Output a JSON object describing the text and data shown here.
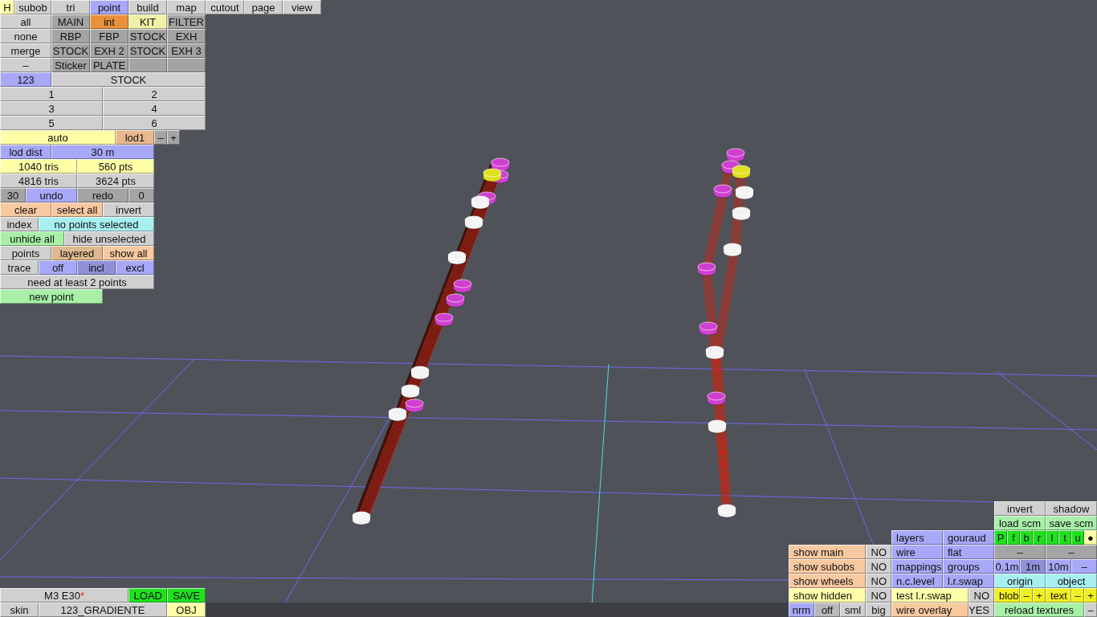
{
  "help_button": {
    "label": "H",
    "color": "#ffffa8"
  },
  "tabs": [
    {
      "label": "subob",
      "selected": false
    },
    {
      "label": "tri",
      "selected": false
    },
    {
      "label": "point",
      "selected": true
    },
    {
      "label": "build",
      "selected": false
    },
    {
      "label": "map",
      "selected": false
    },
    {
      "label": "cutout",
      "selected": false
    },
    {
      "label": "page",
      "selected": false
    },
    {
      "label": "view",
      "selected": false
    }
  ],
  "left_panel": [
    [
      {
        "label": "all",
        "color": "#d0d0d0"
      },
      {
        "label": "MAIN",
        "color": "#a4a4a4"
      },
      {
        "label": "int",
        "color": "#e8903c"
      },
      {
        "label": "KIT",
        "color": "#f0f0a8"
      },
      {
        "label": "FILTER",
        "color": "#a4a4a4"
      }
    ],
    [
      {
        "label": "none",
        "color": "#d0d0d0"
      },
      {
        "label": "RBP",
        "color": "#a4a4a4"
      },
      {
        "label": "FBP",
        "color": "#a4a4a4"
      },
      {
        "label": "STOCK",
        "color": "#a4a4a4"
      },
      {
        "label": "EXH",
        "color": "#a4a4a4"
      }
    ],
    [
      {
        "label": "merge",
        "color": "#d0d0d0"
      },
      {
        "label": "STOCK",
        "color": "#a4a4a4"
      },
      {
        "label": "EXH 2",
        "color": "#a4a4a4"
      },
      {
        "label": "STOCK",
        "color": "#a4a4a4"
      },
      {
        "label": "EXH 3",
        "color": "#a4a4a4"
      }
    ],
    [
      {
        "label": "–",
        "color": "#d0d0d0"
      },
      {
        "label": "Sticker",
        "color": "#a4a4a4"
      },
      {
        "label": "PLATE",
        "color": "#a4a4a4"
      },
      {
        "color": "#a4a4a4"
      },
      {
        "color": "#a4a4a4"
      }
    ],
    [
      {
        "label": "123",
        "color": "#a8a8f8"
      },
      {
        "label": "STOCK",
        "color": "#d0d0d0"
      }
    ],
    [
      {
        "label": "1",
        "color": "#d0d0d0"
      },
      {
        "label": "2",
        "color": "#d0d0d0"
      }
    ],
    [
      {
        "label": "3",
        "color": "#d0d0d0"
      },
      {
        "label": "4",
        "color": "#d0d0d0"
      }
    ],
    [
      {
        "label": "5",
        "color": "#d0d0d0"
      },
      {
        "label": "6",
        "color": "#d0d0d0"
      }
    ],
    [
      {
        "label": "auto",
        "color": "#ffffa8"
      },
      {
        "label": "lod1",
        "color": "#e8b890"
      },
      {
        "label": "–",
        "color": "#a4a4a4"
      },
      {
        "label": "+",
        "color": "#a4a4a4"
      }
    ],
    [
      {
        "label": "lod dist",
        "color": "#a8a8f8"
      },
      {
        "label": "30 m",
        "color": "#a8a8f8"
      }
    ],
    [
      {
        "label": "1040 tris",
        "color": "#ffffa8"
      },
      {
        "label": "560 pts",
        "color": "#ffffa8"
      }
    ],
    [
      {
        "label": "4816 tris",
        "color": "#d0d0d0"
      },
      {
        "label": "3624 pts",
        "color": "#d0d0d0"
      }
    ],
    [
      {
        "label": "30",
        "color": "#a4a4a4"
      },
      {
        "label": "undo",
        "color": "#a8a8f8"
      },
      {
        "label": "redo",
        "color": "#a4a4a4"
      },
      {
        "label": "0",
        "color": "#a4a4a4"
      }
    ],
    [
      {
        "label": "clear",
        "color": "#f8c8a0"
      },
      {
        "label": "select all",
        "color": "#f8c8a0"
      },
      {
        "label": "invert",
        "color": "#d0d0d0"
      }
    ],
    [
      {
        "label": "index",
        "color": "#d0d0d0"
      },
      {
        "label": "no points selected",
        "color": "#a8f0f0"
      }
    ],
    [
      {
        "label": "unhide all",
        "color": "#a8f0a8"
      },
      {
        "label": "hide unselected",
        "color": "#d0d0d0"
      }
    ],
    [
      {
        "label": "points",
        "color": "#d0d0d0"
      },
      {
        "label": "layered",
        "color": "#e0b890"
      },
      {
        "label": "show all",
        "color": "#f8c8a0"
      }
    ],
    [
      {
        "label": "trace",
        "color": "#d0d0d0"
      },
      {
        "label": "off",
        "color": "#a8a8f8"
      },
      {
        "label": "incl",
        "color": "#9090d8"
      },
      {
        "label": "excl",
        "color": "#a8a8f8"
      }
    ],
    [
      {
        "label": "need at least 2 points",
        "color": "#d0d0d0"
      }
    ],
    [
      {
        "label": "new point",
        "color": "#a8f0a8"
      }
    ]
  ],
  "file_panel": [
    [
      {
        "label": "M3 E30",
        "mark": "*",
        "color": "#d0d0d0"
      },
      {
        "label": "LOAD",
        "color": "#20e020"
      },
      {
        "label": "SAVE",
        "color": "#20e020"
      }
    ],
    [
      {
        "label": "skin",
        "color": "#d0d0d0"
      },
      {
        "label": "123_GRADIENTE",
        "color": "#d0d0d0"
      },
      {
        "label": "OBJ",
        "color": "#ffffa8"
      }
    ]
  ],
  "view_panel": [
    [
      {
        "label": "invert",
        "color": "#d0d0d0"
      },
      {
        "label": "shadow",
        "color": "#d0d0d0"
      }
    ],
    [
      {
        "label": "load scm",
        "color": "#a8f0a8"
      },
      {
        "label": "save scm",
        "color": "#a8f0a8"
      }
    ],
    [
      {
        "label": "layers",
        "color": "#a8a8f8"
      },
      {
        "label": "gouraud",
        "color": "#a8a8f8"
      },
      {
        "label": "P",
        "color": "#20e020"
      },
      {
        "label": "f",
        "color": "#20e020"
      },
      {
        "label": "b",
        "color": "#20e020"
      },
      {
        "label": "r",
        "color": "#20e020"
      },
      {
        "label": "l",
        "color": "#20e020"
      },
      {
        "label": "t",
        "color": "#20e020"
      },
      {
        "label": "u",
        "color": "#20e020"
      },
      {
        "label": "●",
        "color": "#ffffa8"
      }
    ],
    [
      {
        "label": "show main",
        "color": "#f8c8a0"
      },
      {
        "label": "NO",
        "color": "#d0d0d0"
      },
      {
        "label": "wire",
        "color": "#a8a8f8"
      },
      {
        "label": "flat",
        "color": "#a8a8f8"
      },
      {
        "label": "–",
        "color": "#a4a4a4"
      },
      {
        "label": "–",
        "color": "#a4a4a4"
      }
    ],
    [
      {
        "label": "show subobs",
        "color": "#f8c8a0"
      },
      {
        "label": "NO",
        "color": "#d0d0d0"
      },
      {
        "label": "mappings",
        "color": "#a8a8f8"
      },
      {
        "label": "groups",
        "color": "#a8a8f8"
      },
      {
        "label": "0.1m",
        "color": "#a8a8f8"
      },
      {
        "label": "1m",
        "color": "#9090d8"
      },
      {
        "label": "10m",
        "color": "#a8a8f8"
      },
      {
        "label": "–",
        "color": "#a8a8f8"
      }
    ],
    [
      {
        "label": "show wheels",
        "color": "#f8c8a0"
      },
      {
        "label": "NO",
        "color": "#d0d0d0"
      },
      {
        "label": "n.c.level",
        "color": "#a8a8f8"
      },
      {
        "label": "l.r.swap",
        "color": "#a8a8f8"
      },
      {
        "label": "origin",
        "color": "#a8f0f0"
      },
      {
        "label": "object",
        "color": "#a8f0f0"
      }
    ],
    [
      {
        "label": "show hidden",
        "color": "#ffffa8"
      },
      {
        "label": "NO",
        "color": "#d0d0d0"
      },
      {
        "label": "test l.r.swap",
        "color": "#ffffa8"
      },
      {
        "label": "NO",
        "color": "#d0d0d0"
      },
      {
        "label": "blob",
        "color": "#f0f020"
      },
      {
        "label": "–",
        "color": "#f0f020"
      },
      {
        "label": "+",
        "color": "#f0f020"
      },
      {
        "label": "text",
        "color": "#f0f020"
      },
      {
        "label": "–",
        "color": "#f0f020"
      },
      {
        "label": "+",
        "color": "#f0f020"
      }
    ],
    [
      {
        "label": "nrm",
        "color": "#a8a8f8"
      },
      {
        "label": "off",
        "color": "#b8b8b8"
      },
      {
        "label": "sml",
        "color": "#d0d0d0"
      },
      {
        "label": "big",
        "color": "#d0d0d0"
      },
      {
        "label": "wire overlay",
        "color": "#f8c8a0"
      },
      {
        "label": "YES",
        "color": "#d0d0d0"
      },
      {
        "label": "reload textures",
        "color": "#a8f0a8"
      },
      {
        "label": "–",
        "color": "#d0d0d0"
      }
    ]
  ]
}
